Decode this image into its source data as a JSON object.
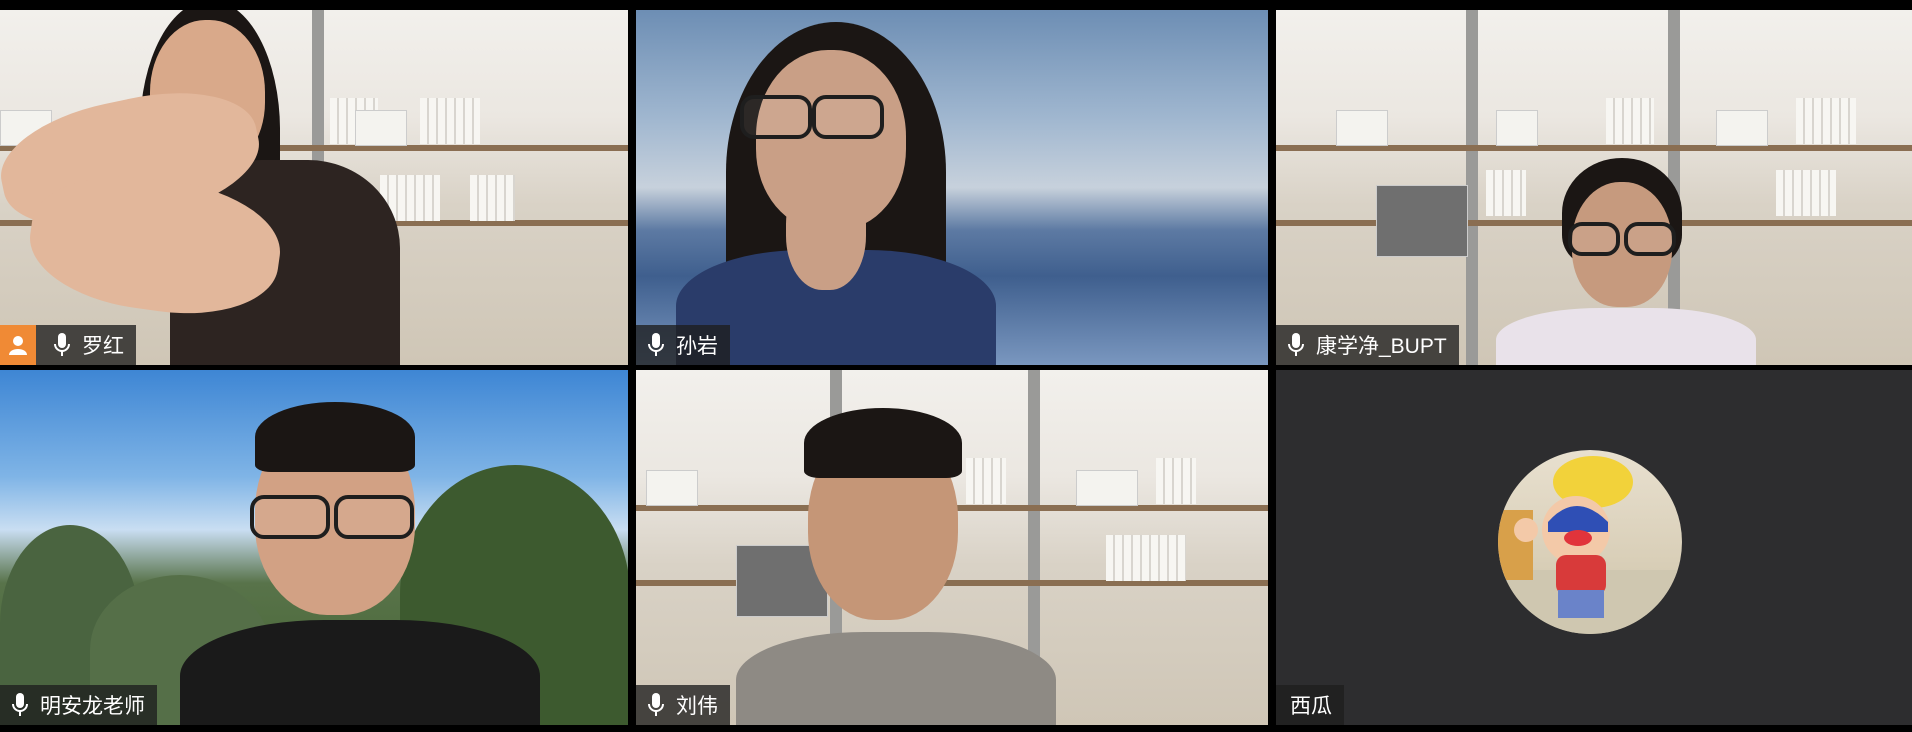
{
  "meeting": {
    "participants": [
      {
        "name": "罗红",
        "has_avatar_badge": true,
        "mic": "on"
      },
      {
        "name": "孙岩",
        "mic": "on"
      },
      {
        "name": "康学净_BUPT",
        "mic": "on"
      },
      {
        "name": "明安龙老师",
        "mic": "on"
      },
      {
        "name": "刘伟",
        "mic": "on"
      },
      {
        "name": "西瓜",
        "video": "off",
        "mic": "none"
      }
    ]
  },
  "colors": {
    "label_bg": "#1e1e1e",
    "avatar_badge": "#f08a35",
    "tile_off_bg": "#2d2d2f"
  },
  "icons": {
    "mic": "microphone-icon",
    "person": "person-icon"
  }
}
